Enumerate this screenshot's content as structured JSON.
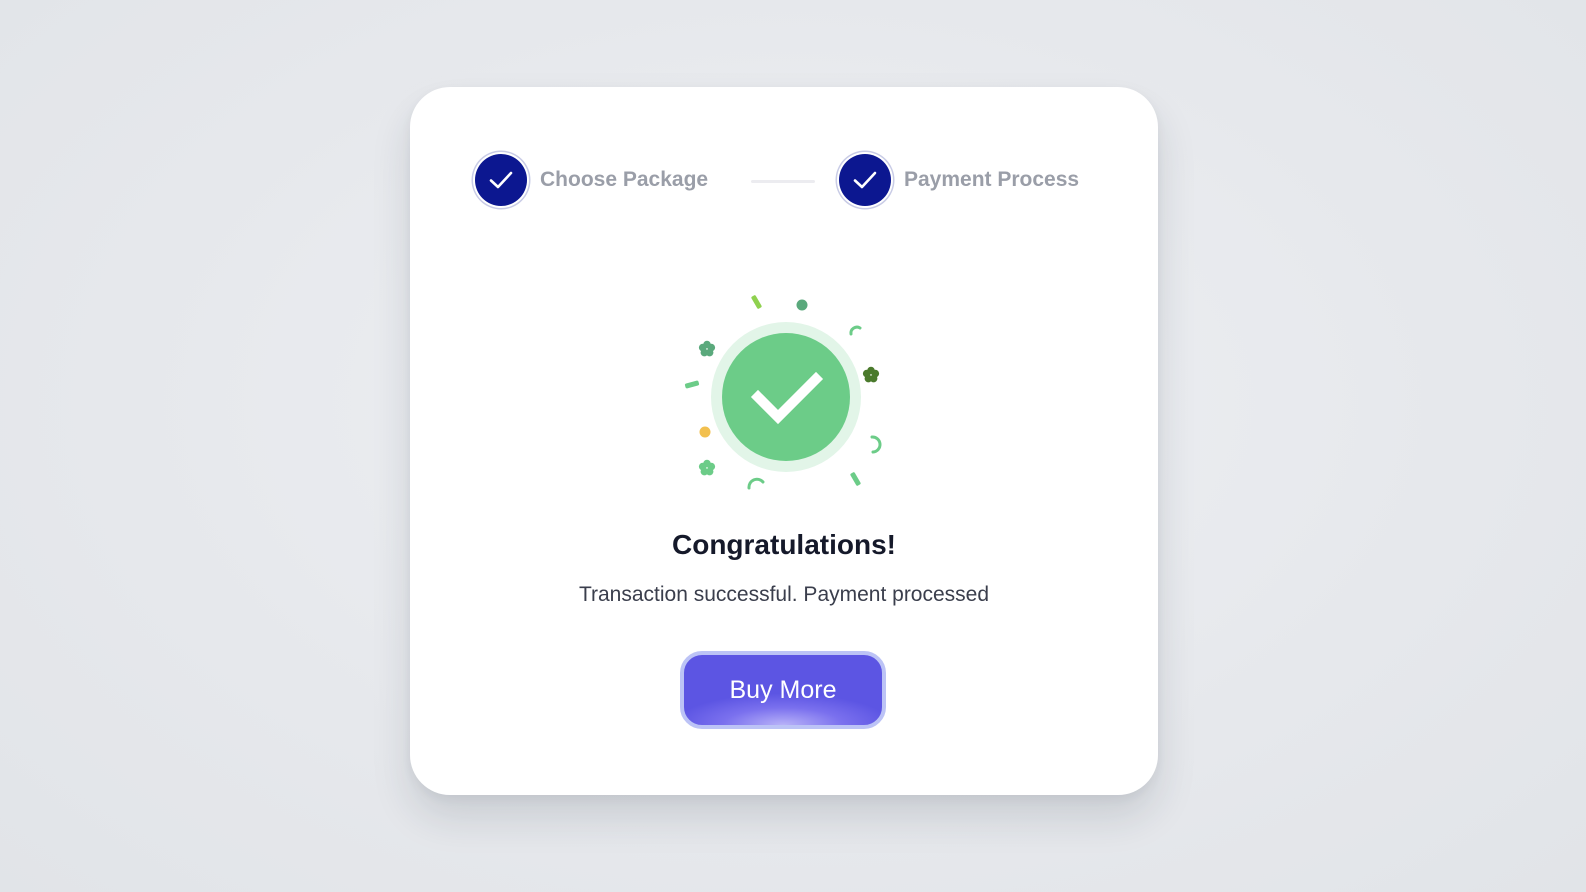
{
  "stepper": {
    "steps": [
      {
        "label": "Choose Package",
        "completed": true,
        "icon": "check-icon"
      },
      {
        "label": "Payment Process",
        "completed": true,
        "icon": "check-icon"
      }
    ]
  },
  "success": {
    "icon": "success-check-icon",
    "title": "Congratulations!",
    "message": "Transaction successful. Payment processed"
  },
  "actions": {
    "buy_more_label": "Buy More"
  },
  "colors": {
    "step_complete": "#0c1790",
    "success_green": "#6ccc88",
    "button_primary": "#5c55e3"
  }
}
